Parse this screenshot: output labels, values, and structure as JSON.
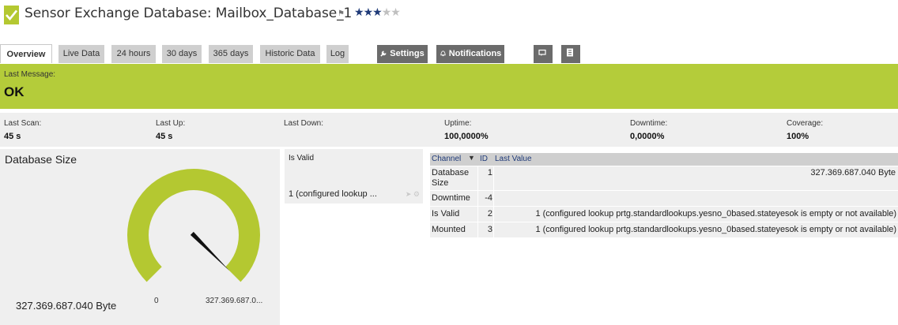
{
  "header": {
    "title": "Sensor Exchange Database: Mailbox_Database_1",
    "flag_icon": "flag-icon",
    "rating": {
      "value": 3,
      "max": 5
    },
    "status_color": "#b4c831"
  },
  "tabs": [
    {
      "label": "Overview",
      "active": true
    },
    {
      "label": "Live Data"
    },
    {
      "label": "24 hours"
    },
    {
      "label": "30 days"
    },
    {
      "label": "365 days"
    },
    {
      "label": "Historic Data"
    },
    {
      "label": "Log"
    },
    {
      "label": "Settings",
      "icon": "wrench-icon"
    },
    {
      "label": "Notifications",
      "icon": "bell-icon"
    }
  ],
  "tab_icons": [
    "comment-icon",
    "list-icon"
  ],
  "message": {
    "label": "Last Message:",
    "value": "OK",
    "color": "#b4cc3a"
  },
  "stats": [
    {
      "label": "Last Scan:",
      "value": "45 s"
    },
    {
      "label": "Last Up:",
      "value": "45 s"
    },
    {
      "label": "Last Down:",
      "value": ""
    },
    {
      "label": "Uptime:",
      "value": "100,0000%"
    },
    {
      "label": "Downtime:",
      "value": "0,0000%"
    },
    {
      "label": "Coverage:",
      "value": "100%"
    }
  ],
  "gauge": {
    "title": "Database Size",
    "value_text": "327.369.687.040 Byte",
    "min_label": "0",
    "max_label": "327.369.687.0...",
    "fill_fraction": 1.0,
    "color": "#b4c831"
  },
  "is_valid_panel": {
    "title": "Is Valid",
    "value": "1 (configured lookup ..."
  },
  "channel_table": {
    "headers": {
      "channel": "Channel",
      "id": "ID",
      "last_value": "Last Value"
    },
    "rows": [
      {
        "channel": "Database Size",
        "id": "1",
        "last_value": "327.369.687.040 Byte"
      },
      {
        "channel": "Downtime",
        "id": "-4",
        "last_value": ""
      },
      {
        "channel": "Is Valid",
        "id": "2",
        "last_value": "1 (configured lookup prtg.standardlookups.yesno_0based.stateyesok is empty or not available)"
      },
      {
        "channel": "Mounted",
        "id": "3",
        "last_value": "1 (configured lookup prtg.standardlookups.yesno_0based.stateyesok is empty or not available)"
      }
    ]
  }
}
